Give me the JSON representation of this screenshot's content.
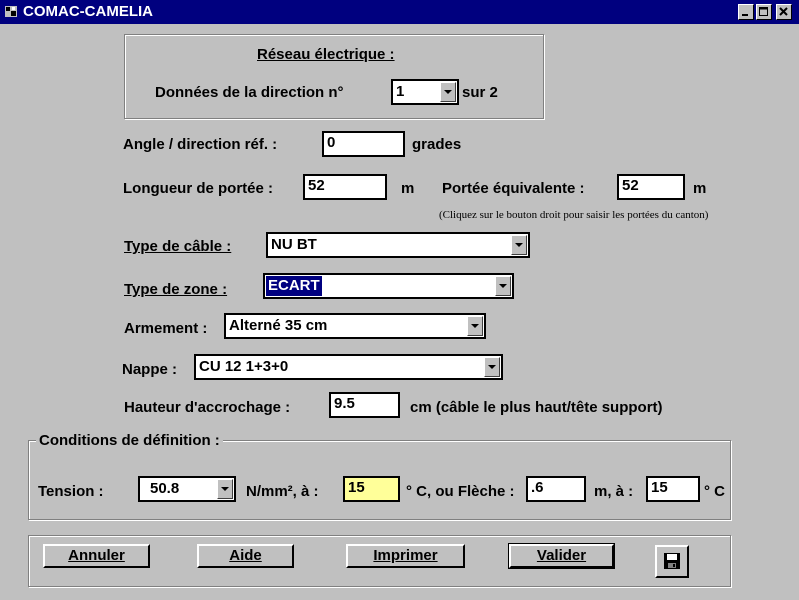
{
  "window": {
    "title": "COMAC-CAMELIA",
    "controls": [
      "minimize-icon",
      "maximize-icon",
      "close-icon"
    ]
  },
  "reseau": {
    "heading": "Réseau électrique :",
    "direction_label": "Données de la direction n°",
    "direction_value": "1",
    "direction_total": "sur 2"
  },
  "angle": {
    "label": "Angle / direction réf. :",
    "value": "0",
    "unit": "grades"
  },
  "portee": {
    "label": "Longueur de portée :",
    "value": "52",
    "unit": "m",
    "equiv_label": "Portée équivalente :",
    "equiv_value": "52",
    "equiv_unit": "m",
    "hint": "(Cliquez sur le bouton droit pour saisir les portées du canton)"
  },
  "cable": {
    "label": "Type de câble :",
    "value": "NU BT"
  },
  "zone": {
    "label": "Type de zone :",
    "value": "ECART"
  },
  "armement": {
    "label": "Armement :",
    "value": "Alterné 35 cm"
  },
  "nappe": {
    "label": "Nappe :",
    "value": "CU 12 1+3+0"
  },
  "hauteur": {
    "label": "Hauteur d'accrochage :",
    "value": "9.5",
    "unit": "cm  (câble le plus haut/tête support)"
  },
  "conditions": {
    "heading": "Conditions de définition :",
    "tension_label": "Tension :",
    "tension_value": "50.8",
    "unit1": "N/mm², à :",
    "temp1": "15",
    "fleche_label": "° C, ou Flèche :",
    "fleche_value": ".6",
    "unit2": "m, à :",
    "temp2": "15",
    "unit3": "° C"
  },
  "buttons": {
    "cancel": "Annuler",
    "help": "Aide",
    "print": "Imprimer",
    "validate": "Valider",
    "save_icon": "floppy-disk-icon"
  },
  "colors": {
    "titlebar": "#00007f",
    "selection": "#000080",
    "highlight_field": "#ffff99",
    "face": "#c0c0c0"
  }
}
